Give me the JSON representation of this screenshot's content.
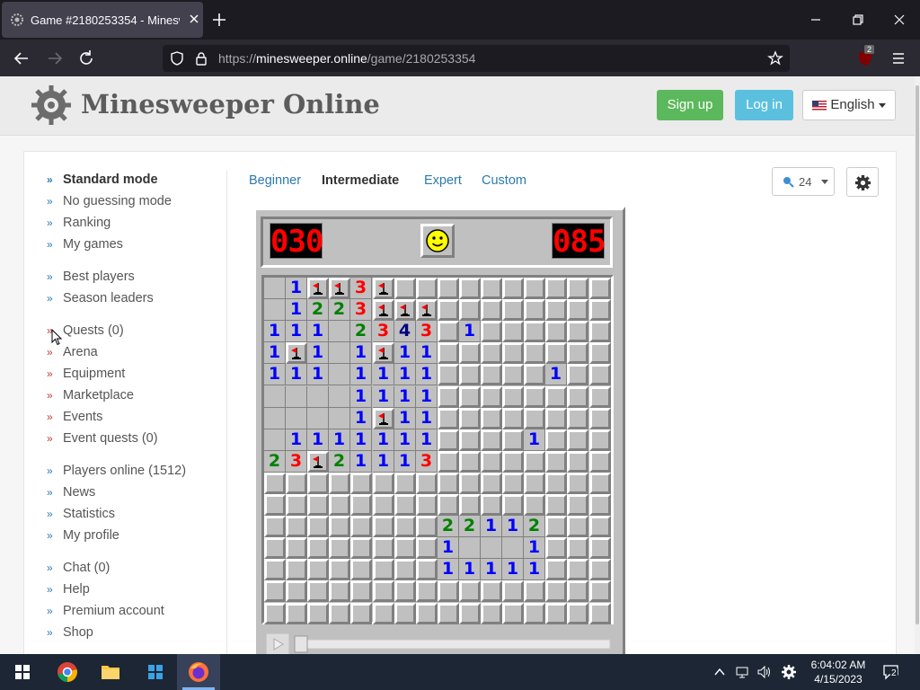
{
  "browser": {
    "tab_title": "Game #2180253354 - Minesweeper Online",
    "url_prefix": "https://",
    "url_host": "minesweeper.online",
    "url_path": "/game/2180253354",
    "ublock_badge": "2"
  },
  "header": {
    "brand": "Minesweeper Online",
    "signup_label": "Sign up",
    "login_label": "Log in",
    "language_label": "English"
  },
  "sidebar": {
    "items": [
      {
        "label": "Standard mode"
      },
      {
        "label": "No guessing mode"
      },
      {
        "label": "Ranking"
      },
      {
        "label": "My games"
      },
      {
        "label": "Best players"
      },
      {
        "label": "Season leaders"
      },
      {
        "label": "Quests (0)"
      },
      {
        "label": "Arena"
      },
      {
        "label": "Equipment"
      },
      {
        "label": "Marketplace"
      },
      {
        "label": "Events"
      },
      {
        "label": "Event quests (0)"
      },
      {
        "label": "Players online (1512)"
      },
      {
        "label": "News"
      },
      {
        "label": "Statistics"
      },
      {
        "label": "My profile"
      },
      {
        "label": "Chat (0)"
      },
      {
        "label": "Help"
      },
      {
        "label": "Premium account"
      },
      {
        "label": "Shop"
      }
    ]
  },
  "levels": {
    "beginner": "Beginner",
    "intermediate": "Intermediate",
    "expert": "Expert",
    "custom": "Custom"
  },
  "zoom": {
    "value": "24"
  },
  "game": {
    "mines_left": "030",
    "timer": "085",
    "colors": {
      "1": "#0000ff",
      "2": "#008000",
      "3": "#ff0000",
      "4": "#000080"
    },
    "rows": [
      [
        "o",
        "1",
        "F",
        "F",
        "3",
        "F",
        "c",
        "c",
        "c",
        "c",
        "c",
        "c",
        "c",
        "c",
        "c",
        "c"
      ],
      [
        "o",
        "1",
        "2",
        "2",
        "3",
        "F",
        "F",
        "F",
        "c",
        "c",
        "c",
        "c",
        "c",
        "c",
        "c",
        "c"
      ],
      [
        "1",
        "1",
        "1",
        "o",
        "2",
        "3",
        "4",
        "3",
        "c",
        "1",
        "c",
        "c",
        "c",
        "c",
        "c",
        "c"
      ],
      [
        "1",
        "F",
        "1",
        "o",
        "1",
        "F",
        "1",
        "1",
        "c",
        "c",
        "c",
        "c",
        "c",
        "c",
        "c",
        "c"
      ],
      [
        "1",
        "1",
        "1",
        "o",
        "1",
        "1",
        "1",
        "1",
        "c",
        "c",
        "c",
        "c",
        "c",
        "1",
        "c",
        "c"
      ],
      [
        "o",
        "o",
        "o",
        "o",
        "1",
        "1",
        "1",
        "1",
        "c",
        "c",
        "c",
        "c",
        "c",
        "c",
        "c",
        "c"
      ],
      [
        "o",
        "o",
        "o",
        "o",
        "1",
        "F",
        "1",
        "1",
        "c",
        "c",
        "c",
        "c",
        "c",
        "c",
        "c",
        "c"
      ],
      [
        "o",
        "1",
        "1",
        "1",
        "1",
        "1",
        "1",
        "1",
        "c",
        "c",
        "c",
        "c",
        "1",
        "c",
        "c",
        "c"
      ],
      [
        "2",
        "3",
        "F",
        "2",
        "1",
        "1",
        "1",
        "3",
        "c",
        "c",
        "c",
        "c",
        "c",
        "c",
        "c",
        "c"
      ],
      [
        "c",
        "c",
        "c",
        "c",
        "c",
        "c",
        "c",
        "c",
        "c",
        "c",
        "c",
        "c",
        "c",
        "c",
        "c",
        "c"
      ],
      [
        "c",
        "c",
        "c",
        "c",
        "c",
        "c",
        "c",
        "c",
        "c",
        "c",
        "c",
        "c",
        "c",
        "c",
        "c",
        "c"
      ],
      [
        "c",
        "c",
        "c",
        "c",
        "c",
        "c",
        "c",
        "c",
        "2",
        "2",
        "1",
        "1",
        "2",
        "c",
        "c",
        "c"
      ],
      [
        "c",
        "c",
        "c",
        "c",
        "c",
        "c",
        "c",
        "c",
        "1",
        "o",
        "o",
        "o",
        "1",
        "c",
        "c",
        "c"
      ],
      [
        "c",
        "c",
        "c",
        "c",
        "c",
        "c",
        "c",
        "c",
        "1",
        "1",
        "1",
        "1",
        "1",
        "c",
        "c",
        "c"
      ],
      [
        "c",
        "c",
        "c",
        "c",
        "c",
        "c",
        "c",
        "c",
        "c",
        "c",
        "c",
        "c",
        "c",
        "c",
        "c",
        "c"
      ],
      [
        "c",
        "c",
        "c",
        "c",
        "c",
        "c",
        "c",
        "c",
        "c",
        "c",
        "c",
        "c",
        "c",
        "c",
        "c",
        "c"
      ]
    ]
  },
  "taskbar": {
    "time": "6:04:02 AM",
    "date": "4/15/2023",
    "notifications": "2"
  }
}
